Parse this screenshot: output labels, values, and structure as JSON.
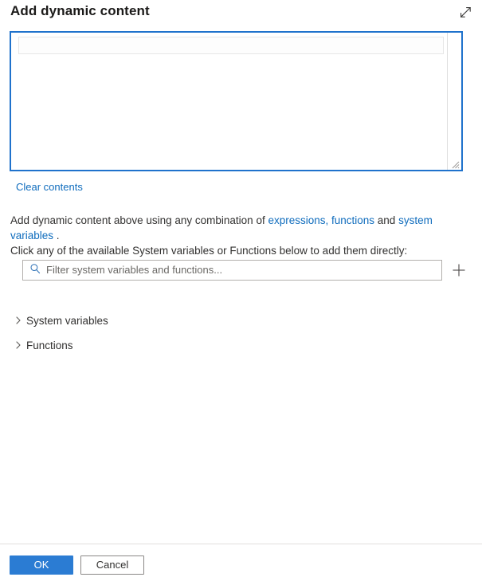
{
  "header": {
    "title": "Add dynamic content",
    "expand_icon": "expand-diagonal-icon"
  },
  "editor": {
    "value": "",
    "clear_label": "Clear contents",
    "resize_handle_icon": "resize-grip-icon"
  },
  "description": {
    "part1": "Add dynamic content above using any combination of ",
    "link1": "expressions, functions",
    "part2": " and ",
    "link2": "system variables",
    "part3": " .",
    "line2": "Click any of the available System variables or Functions below to add them directly:"
  },
  "filter": {
    "placeholder": "Filter system variables and functions...",
    "value": "",
    "search_icon": "search-icon",
    "add_icon": "plus-icon"
  },
  "accordion": {
    "items": [
      {
        "label": "System variables",
        "expanded": false,
        "chevron": "chevron-right-icon"
      },
      {
        "label": "Functions",
        "expanded": false,
        "chevron": "chevron-right-icon"
      }
    ]
  },
  "footer": {
    "ok_label": "OK",
    "cancel_label": "Cancel"
  },
  "colors": {
    "accent": "#0f6cbd",
    "primary_button": "#2b7cd3",
    "editor_focus_border": "#1f72cc",
    "text": "#323130",
    "title": "#1b1a19",
    "placeholder": "#6b6966",
    "divider": "#e1dfdd"
  }
}
